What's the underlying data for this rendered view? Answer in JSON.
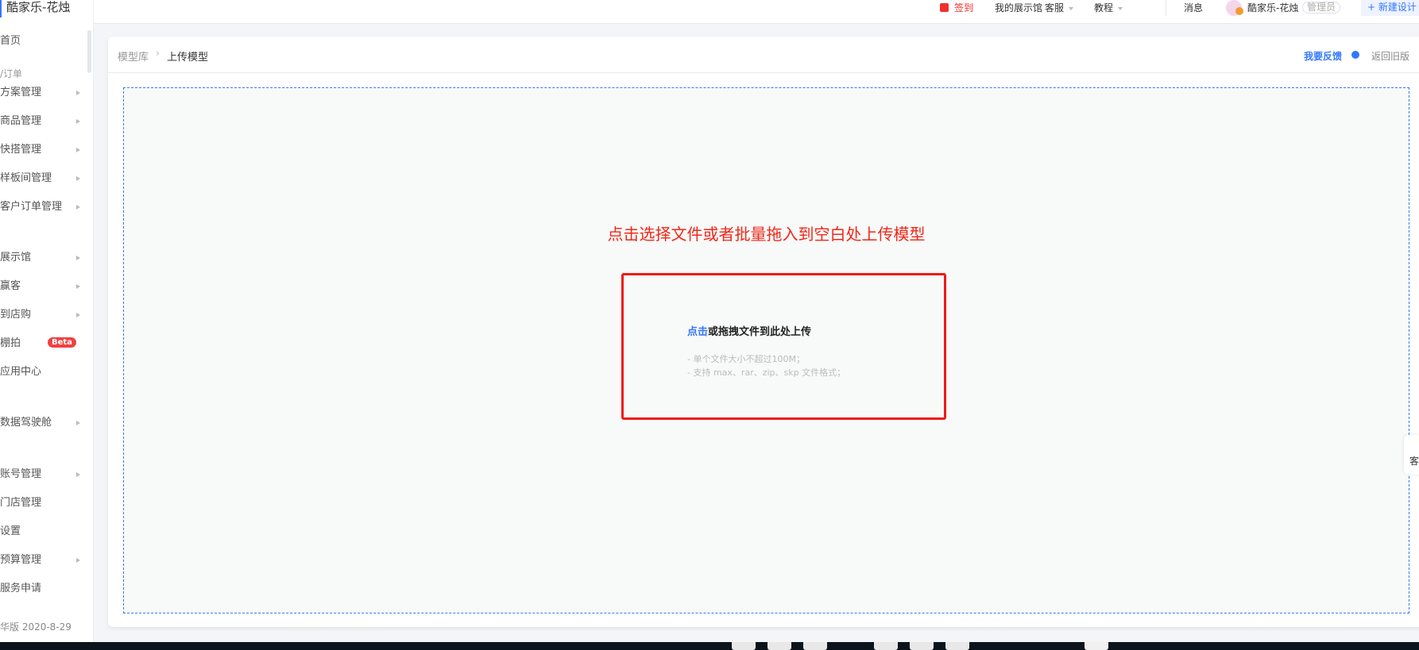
{
  "sidebar": {
    "brand": "酷家乐-花烛",
    "items": [
      {
        "label": "首页",
        "arrow": false
      },
      {
        "label": "/订单",
        "section": true
      },
      {
        "label": "方案管理",
        "arrow": true
      },
      {
        "label": "商品管理",
        "arrow": true
      },
      {
        "label": "快搭管理",
        "arrow": true
      },
      {
        "label": "样板间管理",
        "arrow": true
      },
      {
        "label": "客户订单管理",
        "arrow": true
      },
      {
        "label": "展示馆",
        "arrow": true
      },
      {
        "label": "赢客",
        "arrow": true
      },
      {
        "label": "到店购",
        "arrow": true
      },
      {
        "label": "棚拍",
        "badge": "Beta"
      },
      {
        "label": "应用中心"
      },
      {
        "label": "数据驾驶舱",
        "arrow": true
      },
      {
        "label": "账号管理",
        "arrow": true
      },
      {
        "label": "门店管理"
      },
      {
        "label": "设置"
      },
      {
        "label": "预算管理",
        "arrow": true
      },
      {
        "label": "服务申请"
      }
    ],
    "footer": "华版 2020-8-29"
  },
  "topbar": {
    "checkin": "签到",
    "showroom": "我的展示馆",
    "service": "客服",
    "tutorial": "教程",
    "messages": "消息",
    "username": "酷家乐-花烛",
    "role": "管理员",
    "new_design": "新建设计"
  },
  "header": {
    "breadcrumb_root": "模型库",
    "breadcrumb_current": "上传模型",
    "feedback": "我要反馈",
    "old_version": "返回旧版"
  },
  "upload": {
    "headline": "点击选择文件或者批量拖入到空白处上传模型",
    "click": "点击",
    "drag_text": "或拖拽文件到此处上传",
    "hint1": "- 单个文件大小不超过100M；",
    "hint2": "- 支持 max、rar、zip、skp 文件格式；"
  },
  "float_tab": "客",
  "colors": {
    "accent": "#3377ff",
    "red": "#f02818",
    "beta": "#f04040"
  }
}
